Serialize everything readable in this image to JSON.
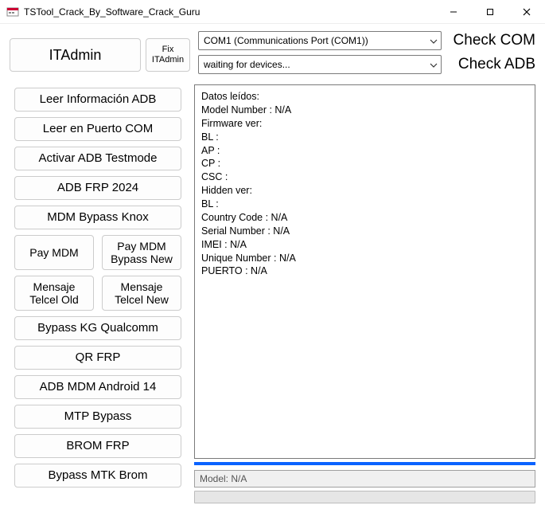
{
  "window": {
    "title": "TSTool_Crack_By_Software_Crack_Guru"
  },
  "top": {
    "itadmin_label": "ITAdmin",
    "fixit_label": "Fix ITAdmin",
    "com_selected": "COM1 (Communications Port (COM1))",
    "adb_selected": "waiting for devices...",
    "check_com_label": "Check COM",
    "check_adb_label": "Check ADB"
  },
  "sidebar": {
    "items": [
      "Leer Información ADB",
      "Leer en Puerto COM",
      "Activar ADB Testmode",
      "ADB FRP 2024",
      "MDM Bypass Knox"
    ],
    "pair1": {
      "a": "Pay MDM",
      "b": "Pay MDM Bypass New"
    },
    "pair2": {
      "a": "Mensaje Telcel Old",
      "b": "Mensaje Telcel New"
    },
    "items2": [
      "Bypass KG Qualcomm",
      "QR FRP",
      "ADB MDM Android 14",
      "MTP Bypass",
      "BROM FRP",
      "Bypass MTK Brom"
    ]
  },
  "log": {
    "text": "Datos leídos:\nModel Number : N/A\nFirmware ver:\nBL :\nAP :\nCP :\nCSC :\nHidden ver:\nBL :\nCountry Code : N/A\nSerial Number : N/A\nIMEI : N/A\nUnique Number : N/A\nPUERTO : N/A"
  },
  "status": {
    "model_label": "Model: N/A"
  }
}
